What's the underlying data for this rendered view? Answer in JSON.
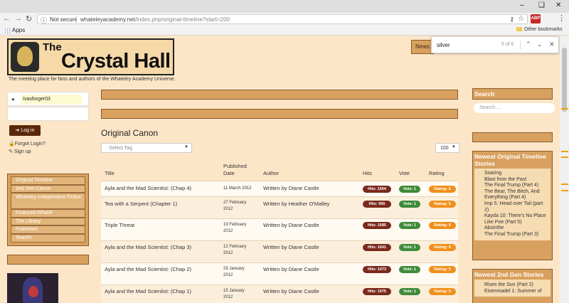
{
  "browser": {
    "security_label": "Not secure",
    "url_host": "whateleyacademy.net",
    "url_path": "/index.php/original-timeline?start=200",
    "bookmarks_apps": "Apps",
    "other_bookmarks": "Other bookmarks",
    "ext_badge": "ABP",
    "find": {
      "query": "silver",
      "count": "5 of 6"
    }
  },
  "site": {
    "logo_the": "The",
    "logo_name": "Crystal Hall",
    "tagline": "The meeting place for fans and authors of the Whateley Academy Universe."
  },
  "topnav": {
    "news": "News"
  },
  "login": {
    "username": "Ivasforger03",
    "login_button": "Log in",
    "forgot": "Forgot Login?",
    "signup": "Sign up"
  },
  "nav": {
    "items": [
      "Original Timeline",
      "2nd Gen Canon",
      "Whateley Independent Fiction",
      "Featured WhatIF",
      "The Library",
      "Published",
      "Search"
    ]
  },
  "main": {
    "heading": "Original Canon",
    "tag_placeholder": "- Select Tag",
    "page_size": "100",
    "columns": {
      "title": "Title",
      "published": "Published Date",
      "author": "Author",
      "hits": "Hits",
      "vote": "Vote",
      "rating": "Rating"
    },
    "rows": [
      {
        "title": "Ayla and the Mad Scientist: (Chap 4)",
        "date": "11 March 2012",
        "author": "Written by Diane Castle",
        "hits": "Hits: 1564",
        "vote": "Vote: 1",
        "rating": "Rating: 5"
      },
      {
        "title": "Tea with a Serpent (Chapter 1)",
        "date": "27 February 2012",
        "author": "Written by Heather O'Malley",
        "hits": "Hits: 965",
        "vote": "Vote: 1",
        "rating": "Rating: 5"
      },
      {
        "title": "Triple Threat",
        "date": "19 February 2012",
        "author": "Written by Diane Castle",
        "hits": "Hits: 1085",
        "vote": "Vote: 1",
        "rating": "Rating: 5"
      },
      {
        "title": "Ayla and the Mad Scientist: (Chap 3)",
        "date": "12 February 2012",
        "author": "Written by Diane Castle",
        "hits": "Hits: 1641",
        "vote": "Vote: 1",
        "rating": "Rating: 5"
      },
      {
        "title": "Ayla and the Mad Scientist: (Chap 2)",
        "date": "29 January 2012",
        "author": "Written by Diane Castle",
        "hits": "Hits: 1473",
        "vote": "Vote: 1",
        "rating": "Rating: 5"
      },
      {
        "title": "Ayla and the Mad Scientist: (Chap 1)",
        "date": "15 January 2012",
        "author": "Written by Diane Castle",
        "hits": "Hits: 1975",
        "vote": "Vote: 1",
        "rating": "Rating: 5"
      }
    ]
  },
  "sidebar_right": {
    "search_title": "Search",
    "search_placeholder": "Search ...",
    "newest_original_title": "Newest Original Timeline Stories",
    "newest_original": [
      "Soaring",
      "Blast from the Past",
      "The Final Trump (Part 4)",
      "The Bear, The Bitch, And Everything (Part 4)",
      "Imp 5. Head over Tail (part 2)",
      "Kayda 10: There's No Place Like Poe (Part 5)",
      "Absinthe",
      "The Final Trump (Part 3)"
    ],
    "newest_2nd_title": "Newest 2nd Gen Stories",
    "newest_2nd": [
      "Rises the Sun (Part 2)",
      "Eisenmadel 1: Summer of"
    ]
  }
}
